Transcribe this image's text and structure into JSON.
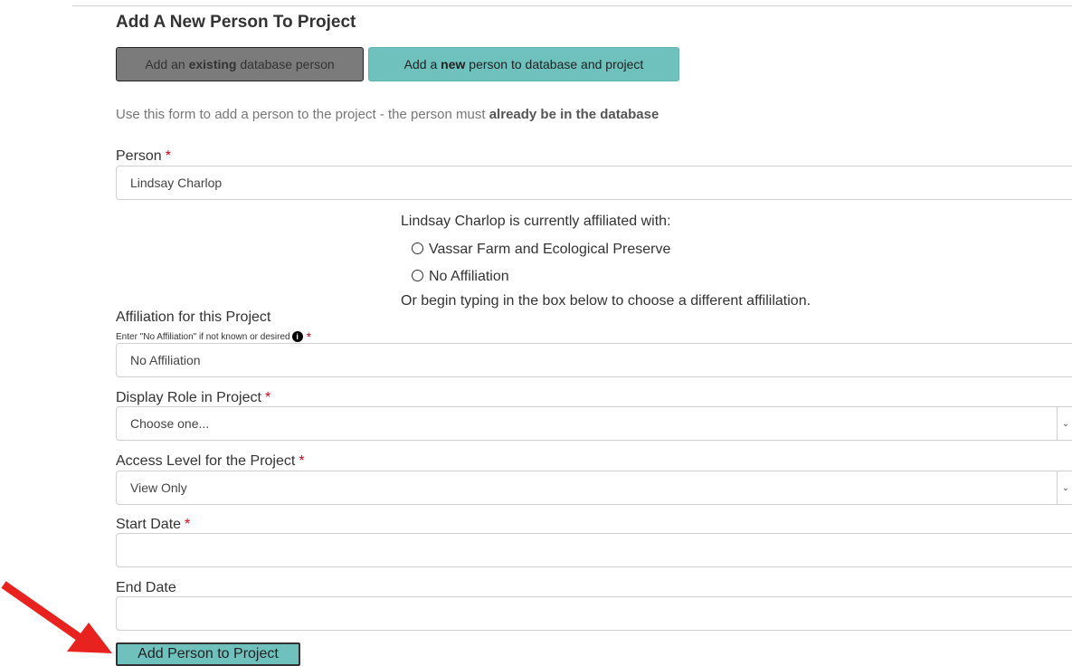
{
  "page_title": "Add A New Person To Project",
  "tabs": {
    "existing": {
      "pre": "Add an ",
      "bold": "existing",
      "post": " database person"
    },
    "new": {
      "pre": "Add a ",
      "bold": "new",
      "post": " person to database and project"
    }
  },
  "intro": {
    "text": "Use this form to add a person to the project - the person must ",
    "bold": "already be in the database"
  },
  "person": {
    "label": "Person",
    "required": "*",
    "value": "Lindsay Charlop"
  },
  "affiliation_info": {
    "heading": "Lindsay Charlop is currently affiliated with:",
    "options": [
      "Vassar Farm and Ecological Preserve",
      "No Affiliation"
    ],
    "hint": "Or begin typing in the box below to choose a different affililation."
  },
  "affiliation": {
    "label": "Affiliation for this Project",
    "sublabel": "Enter \"No Affiliation\" if not known or desired",
    "required": "*",
    "value": "No Affiliation"
  },
  "display_role": {
    "label": "Display Role in Project",
    "required": "*",
    "value": "Choose one..."
  },
  "access_level": {
    "label": "Access Level for the Project",
    "required": "*",
    "value": "View Only"
  },
  "start_date": {
    "label": "Start Date",
    "required": "*",
    "value": ""
  },
  "end_date": {
    "label": "End Date",
    "value": ""
  },
  "submit_label": "Add Person to Project",
  "colors": {
    "teal": "#6ec1bd",
    "gray_button": "#7b7b7b",
    "required": "#d0021b",
    "arrow": "#e8231f"
  },
  "icons": {
    "info": "info-circle-icon",
    "arrow": "red-pointer-arrow",
    "select": "chevron-down-icon"
  }
}
